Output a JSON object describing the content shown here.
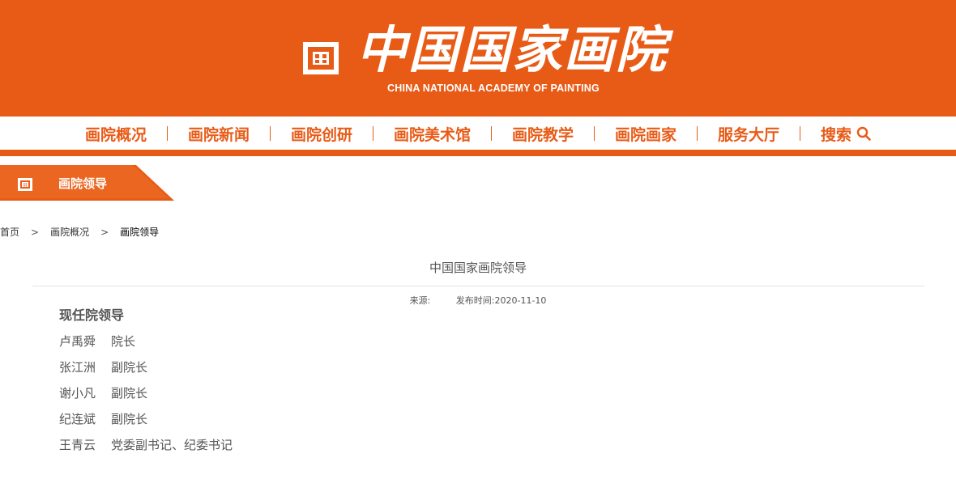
{
  "header": {
    "title_cn": "中国国家画院",
    "title_en": "CHINA NATIONAL ACADEMY OF PAINTING",
    "brand_color": "#e85b17"
  },
  "nav": {
    "items": [
      {
        "label": "画院概况"
      },
      {
        "label": "画院新闻"
      },
      {
        "label": "画院创研"
      },
      {
        "label": "画院美术馆"
      },
      {
        "label": "画院教学"
      },
      {
        "label": "画院画家"
      },
      {
        "label": "服务大厅"
      },
      {
        "label": "搜索",
        "icon": "search-icon"
      }
    ]
  },
  "section": {
    "label": "画院领导",
    "icon": "grid-logo-icon"
  },
  "breadcrumb": {
    "items": [
      "首页",
      "画院概况",
      "画院领导"
    ],
    "separator": ">"
  },
  "article": {
    "title": "中国国家画院领导",
    "source_label": "来源:",
    "date_label": "发布时间:2020-11-10",
    "heading": "现任院领导",
    "leaders": [
      {
        "name": "卢禹舜",
        "role": "院长"
      },
      {
        "name": "张江洲",
        "role": "副院长"
      },
      {
        "name": "谢小凡",
        "role": "副院长"
      },
      {
        "name": "纪连斌",
        "role": "副院长"
      },
      {
        "name": "王青云",
        "role": "党委副书记、纪委书记"
      }
    ]
  }
}
